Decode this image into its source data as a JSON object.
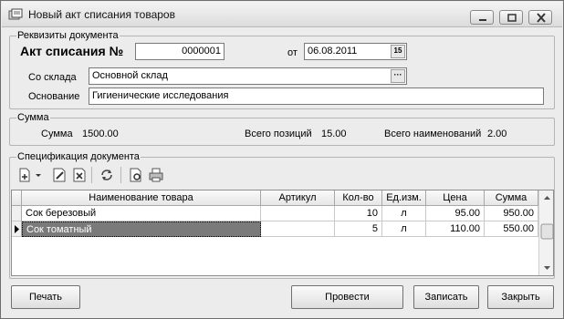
{
  "window": {
    "title": "Новый акт списания товаров"
  },
  "requisites": {
    "group_title": "Реквизиты документа",
    "act_label": "Акт списания №",
    "act_number": "0000001",
    "date_label": "от",
    "date_value": "06.08.2011",
    "warehouse_label": "Со склада",
    "warehouse_value": "Основной склад",
    "basis_label": "Основание",
    "basis_value": "Гигиенические исследования"
  },
  "sum": {
    "group_title": "Сумма",
    "sum_label": "Сумма",
    "sum_value": "1500.00",
    "positions_label": "Всего позиций",
    "positions_value": "15.00",
    "names_label": "Всего наименований",
    "names_value": "2.00"
  },
  "spec": {
    "group_title": "Спецификация документа",
    "toolbar_icons": [
      "add-icon",
      "dropdown-arrow-icon",
      "edit-icon",
      "delete-icon",
      "refresh-icon",
      "preview-icon",
      "print-icon"
    ],
    "columns": {
      "name": "Наименование товара",
      "article": "Артикул",
      "qty": "Кол-во",
      "unit": "Ед.изм.",
      "price": "Цена",
      "total": "Сумма"
    },
    "rows": [
      {
        "name": "Сок березовый",
        "article": "",
        "qty": "10",
        "unit": "л",
        "price": "95.00",
        "total": "950.00"
      },
      {
        "name": "Сок томатный",
        "article": "",
        "qty": "5",
        "unit": "л",
        "price": "110.00",
        "total": "550.00"
      }
    ]
  },
  "buttons": {
    "print": "Печать",
    "post": "Провести",
    "save": "Записать",
    "close": "Закрыть"
  }
}
